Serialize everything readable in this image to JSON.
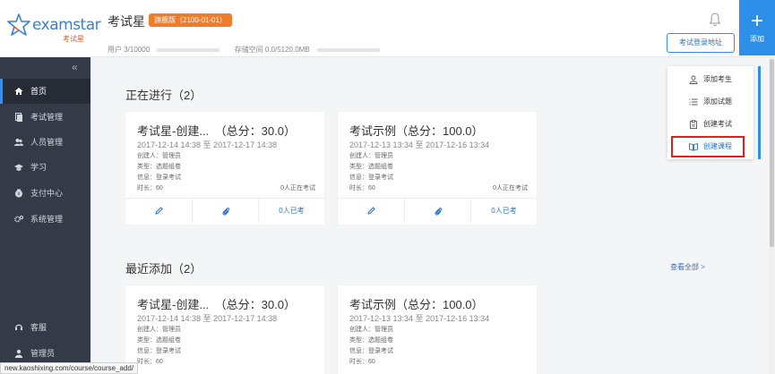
{
  "header": {
    "logo_text": "examstar",
    "logo_subtext": "考试星",
    "title": "考试星",
    "version_badge": "旗舰版（2100-01-01）",
    "users_label": "用户",
    "users_value": "3/10000",
    "users_usage": 0.0003,
    "storage_label": "存储空间",
    "storage_value": "0.0/5120.0MB",
    "storage_usage": 0.0,
    "login_url_button": "考试登录地址",
    "add_button": "添加"
  },
  "sidebar": {
    "collapse_glyph": "«",
    "items": [
      {
        "label": "首页",
        "icon": "home-icon",
        "active": true
      },
      {
        "label": "考试管理",
        "icon": "exam-icon",
        "active": false
      },
      {
        "label": "人员管理",
        "icon": "users-icon",
        "active": false
      },
      {
        "label": "学习",
        "icon": "graduation-cap-icon",
        "active": false
      },
      {
        "label": "支付中心",
        "icon": "payment-icon",
        "active": false
      },
      {
        "label": "系统管理",
        "icon": "gear-icon",
        "active": false
      },
      {
        "label": "客服",
        "icon": "headset-icon",
        "active": false
      },
      {
        "label": "管理员",
        "icon": "user-icon",
        "active": false
      }
    ]
  },
  "sections": {
    "ongoing_title": "正在进行（2）",
    "recent_title": "最近添加（2）",
    "view_all": "查看全部 >"
  },
  "cards": [
    {
      "title": "考试星-创建...　（总分：30.0）",
      "date": "2017-12-14 14:38 至 2017-12-17 14:38",
      "creator": "创建人：管理员",
      "type": "类型：选题组卷",
      "info": "信息：登录考试",
      "duration": "时长：60",
      "status": "0人正在考试",
      "taken": "0人已考"
    },
    {
      "title": "考试示例（总分：100.0）",
      "date": "2017-12-13 13:34 至 2017-12-16 13:34",
      "creator": "创建人：管理员",
      "type": "类型：选题组卷",
      "info": "信息：登录考试",
      "duration": "时长：60",
      "status": "0人正在考试",
      "taken": "0人已考"
    }
  ],
  "dropdown": {
    "items": [
      {
        "label": "添加考生",
        "icon": "add-user-icon"
      },
      {
        "label": "添加试题",
        "icon": "list-icon"
      },
      {
        "label": "创建考试",
        "icon": "clipboard-icon"
      },
      {
        "label": "创建课程",
        "icon": "book-icon"
      }
    ]
  },
  "statusbar": {
    "url": "new.kaoshixing.com/course/course_add/"
  },
  "colors": {
    "accent": "#2e8fe8",
    "sidebar_bg": "#343a48",
    "badge": "#f07b2a",
    "highlight_outline": "#e02020"
  }
}
